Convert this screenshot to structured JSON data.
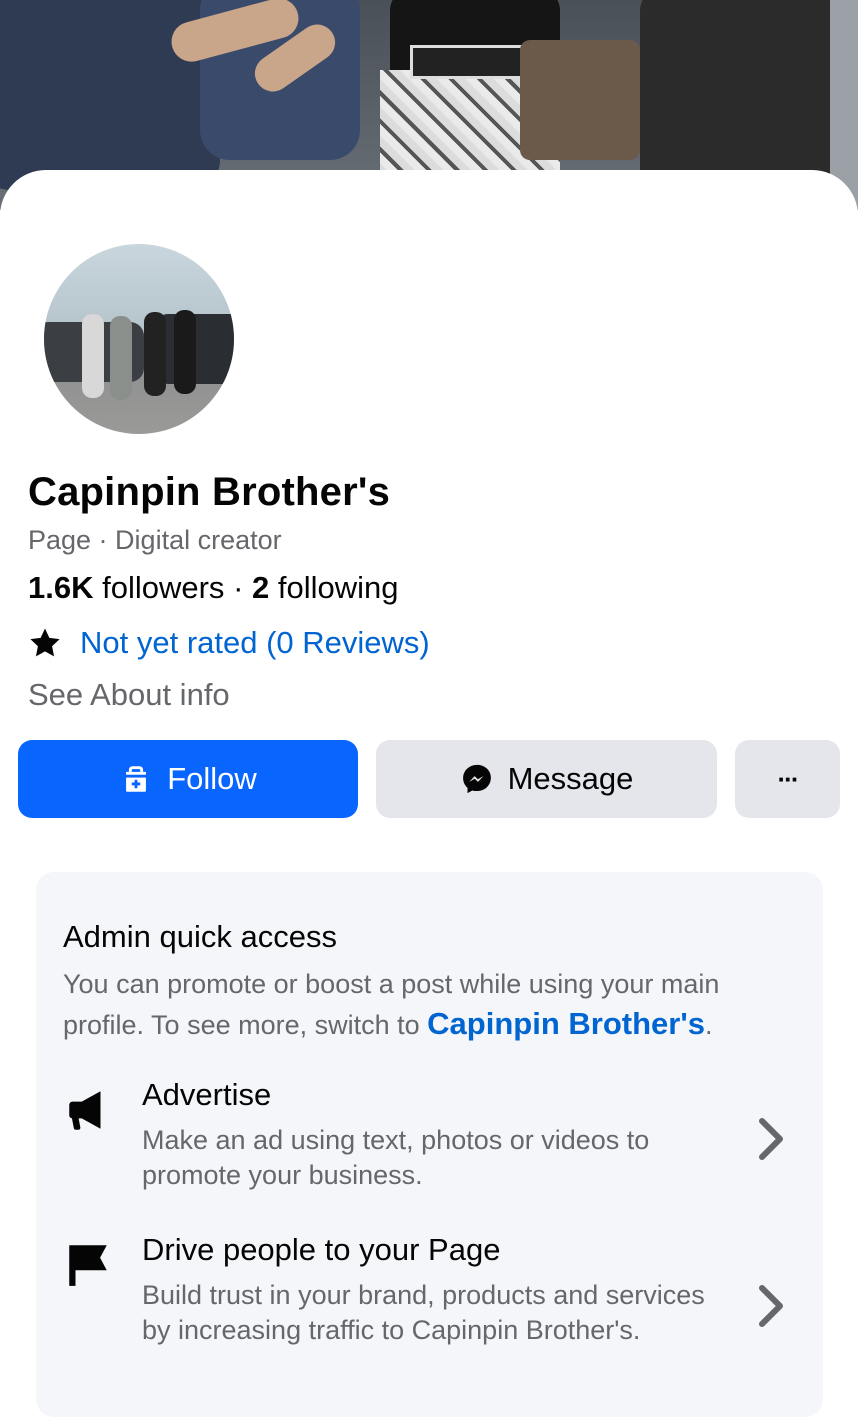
{
  "profile": {
    "name": "Capinpin Brother's",
    "category": "Page · Digital creator",
    "followers_count": "1.6K",
    "followers_label": "followers",
    "separator": "·",
    "following_count": "2",
    "following_label": "following",
    "rating_text": "Not yet rated (0 Reviews)",
    "about_link": "See About info"
  },
  "actions": {
    "follow_label": "Follow",
    "message_label": "Message",
    "more_label": "···"
  },
  "admin": {
    "title": "Admin quick access",
    "desc_prefix": "You can promote or boost a post while using your main profile. To see more, switch to ",
    "desc_link": "Capinpin Brother's",
    "desc_suffix": ".",
    "items": [
      {
        "title": "Advertise",
        "desc": "Make an ad using text, photos or videos to promote your business.",
        "icon": "megaphone-icon"
      },
      {
        "title": "Drive people to your Page",
        "desc": "Build trust in your brand, products and services by increasing traffic to Capinpin Brother's.",
        "icon": "flag-icon"
      }
    ]
  },
  "colors": {
    "primary": "#0866ff",
    "link": "#0064d1",
    "secondary_text": "#65676b",
    "button_gray": "#e4e6eb",
    "card_bg": "#f4f6f9"
  }
}
